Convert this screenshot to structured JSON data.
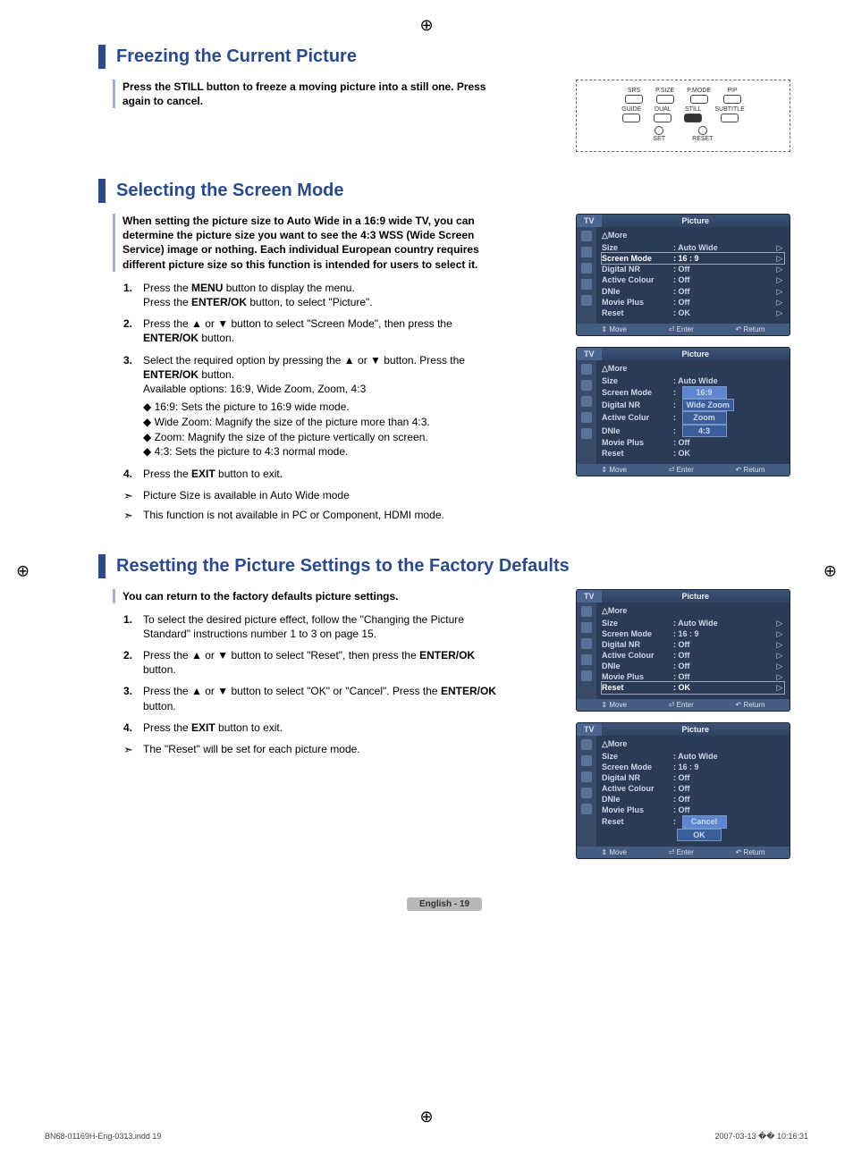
{
  "page": {
    "label": "English - 19"
  },
  "footer": {
    "file": "BN68-01169H-Eng-0313.indd   19",
    "timestamp": "2007-03-13   �� 10:16:31"
  },
  "remote": {
    "row1": [
      "SRS",
      "P.SIZE",
      "P.MODE",
      "PIP"
    ],
    "row2": [
      "GUIDE",
      "DUAL",
      "STILL",
      "SUBTITLE"
    ],
    "row3_left": "SET",
    "row3_right": "RESET"
  },
  "section1": {
    "title": "Freezing the Current Picture",
    "intro": "Press the STILL button to freeze a moving picture into a still one. Press again to cancel."
  },
  "section2": {
    "title": "Selecting the Screen Mode",
    "intro": "When setting the picture size to Auto Wide in a 16:9 wide TV, you can determine the picture size you want to see the 4:3 WSS (Wide Screen Service) image or nothing. Each individual European country requires different picture size so this function is intended for users to select it.",
    "steps": [
      {
        "n": "1.",
        "t": "Press the <b>MENU</b> button to display the menu.<br>Press the <b>ENTER/OK</b> button, to select \"Picture\"."
      },
      {
        "n": "2.",
        "t": "Press the ▲ or ▼ button to select \"Screen Mode\", then press the <b>ENTER/OK</b> button."
      },
      {
        "n": "3.",
        "t": "Select the required option by pressing the ▲ or ▼ button. Press the <b>ENTER/OK</b> button.<br>Available options: 16:9, Wide Zoom, Zoom, 4:3"
      },
      {
        "n": "4.",
        "t": "Press the <b>EXIT</b> button to exit."
      }
    ],
    "subbullets": [
      "◆ 16:9: Sets the picture to 16:9 wide mode.",
      "◆ Wide Zoom: Magnify the size of the picture more than 4:3.",
      "◆ Zoom: Magnify the size of the picture vertically on screen.",
      "◆ 4:3: Sets the picture to 4:3 normal mode."
    ],
    "notes": [
      "Picture Size is available in Auto Wide mode",
      "This function is not available in PC or Component, HDMI mode."
    ]
  },
  "section3": {
    "title": "Resetting the Picture Settings to the Factory Defaults",
    "intro": "You can return to the factory defaults picture settings.",
    "steps": [
      {
        "n": "1.",
        "t": "To select the desired picture effect, follow the \"Changing the Picture Standard\" instructions number 1 to 3 on page 15."
      },
      {
        "n": "2.",
        "t": "Press the ▲ or ▼ button to select \"Reset\", then press the <b>ENTER/OK</b> button."
      },
      {
        "n": "3.",
        "t": "Press the ▲ or ▼ button to select \"OK\" or \"Cancel\". Press the <b>ENTER/OK</b> button."
      },
      {
        "n": "4.",
        "t": "Press the <b>EXIT</b> button to exit."
      }
    ],
    "notes": [
      "The \"Reset\" will be set for each picture mode."
    ]
  },
  "osd_common": {
    "tv": "TV",
    "title": "Picture",
    "more": "△More",
    "foot_move": "Move",
    "foot_enter": "Enter",
    "foot_return": "Return"
  },
  "osd1": {
    "rows": [
      {
        "lbl": "Size",
        "val": ": Auto Wide",
        "arrow": true
      },
      {
        "lbl": "Screen Mode",
        "val": ": 16 : 9",
        "arrow": true,
        "sel": true
      },
      {
        "lbl": "Digital NR",
        "val": ": Off",
        "arrow": true
      },
      {
        "lbl": "Active Colour",
        "val": ": Off",
        "arrow": true
      },
      {
        "lbl": "DNIe",
        "val": ": Off",
        "arrow": true
      },
      {
        "lbl": "Movie Plus",
        "val": ": Off",
        "arrow": true
      },
      {
        "lbl": "Reset",
        "val": ": OK",
        "arrow": true
      }
    ]
  },
  "osd2": {
    "rows": [
      {
        "lbl": "Size",
        "val": ": Auto Wide"
      },
      {
        "lbl": "Screen Mode",
        "val": ":",
        "opt": "16:9",
        "optsel": true
      },
      {
        "lbl": "Digital NR",
        "val": ":",
        "opt": "Wide Zoom"
      },
      {
        "lbl": "Active Colur",
        "val": ":",
        "opt": "Zoom"
      },
      {
        "lbl": "DNIe",
        "val": ":",
        "opt": "4:3"
      },
      {
        "lbl": "Movie Plus",
        "val": ": Off"
      },
      {
        "lbl": "Reset",
        "val": ": OK"
      }
    ]
  },
  "osd3": {
    "rows": [
      {
        "lbl": "Size",
        "val": ": Auto Wide",
        "arrow": true
      },
      {
        "lbl": "Screen Mode",
        "val": ": 16 : 9",
        "arrow": true
      },
      {
        "lbl": "Digital NR",
        "val": ": Off",
        "arrow": true
      },
      {
        "lbl": "Active Colour",
        "val": ": Off",
        "arrow": true
      },
      {
        "lbl": "DNIe",
        "val": ": Off",
        "arrow": true
      },
      {
        "lbl": "Movie Plus",
        "val": ": Off",
        "arrow": true
      },
      {
        "lbl": "Reset",
        "val": ": OK",
        "arrow": true,
        "sel": true
      }
    ]
  },
  "osd4": {
    "rows": [
      {
        "lbl": "Size",
        "val": ": Auto Wide"
      },
      {
        "lbl": "Screen Mode",
        "val": ": 16 : 9"
      },
      {
        "lbl": "Digital NR",
        "val": ": Off"
      },
      {
        "lbl": "Active Colour",
        "val": ": Off"
      },
      {
        "lbl": "DNIe",
        "val": ": Off"
      },
      {
        "lbl": "Movie Plus",
        "val": ": Off"
      },
      {
        "lbl": "Reset",
        "val": ":",
        "opt": "Cancel",
        "optsel": true
      },
      {
        "lbl": "",
        "val": "",
        "opt": "OK"
      }
    ]
  }
}
